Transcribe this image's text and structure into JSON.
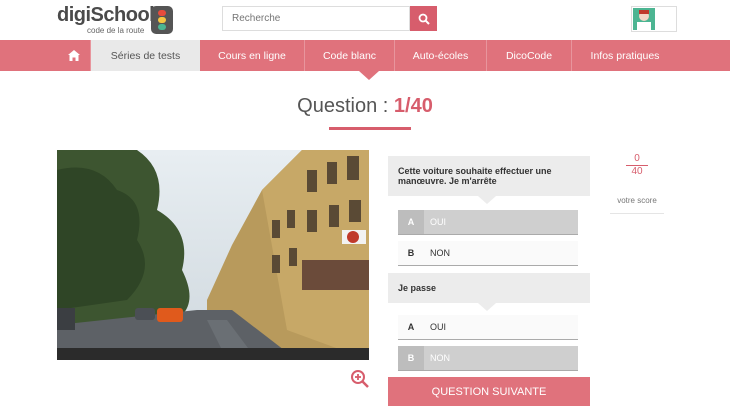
{
  "brand": {
    "name": "digiSchool",
    "subtitle": "code de la route"
  },
  "search": {
    "placeholder": "Recherche"
  },
  "nav": {
    "items": [
      {
        "label": "Séries de tests",
        "active": true
      },
      {
        "label": "Cours en ligne"
      },
      {
        "label": "Code blanc"
      },
      {
        "label": "Auto-écoles"
      },
      {
        "label": "DicoCode"
      },
      {
        "label": "Infos pratiques"
      }
    ]
  },
  "question": {
    "prefix": "Question :",
    "number": "1/40"
  },
  "quiz": {
    "q1": {
      "text": "Cette voiture souhaite effectuer une manœuvre. Je m'arrête",
      "answers": [
        {
          "letter": "A",
          "text": "OUI",
          "selected": true
        },
        {
          "letter": "B",
          "text": "NON",
          "selected": false
        }
      ]
    },
    "q2": {
      "text": "Je passe",
      "answers": [
        {
          "letter": "A",
          "text": "OUI",
          "selected": false
        },
        {
          "letter": "B",
          "text": "NON",
          "selected": true
        }
      ]
    }
  },
  "next_button": "QUESTION SUIVANTE",
  "score": {
    "numerator": "0",
    "denominator": "40",
    "label": "votre score"
  },
  "colors": {
    "accent": "#e0727c",
    "accent_dark": "#d75d6c"
  }
}
